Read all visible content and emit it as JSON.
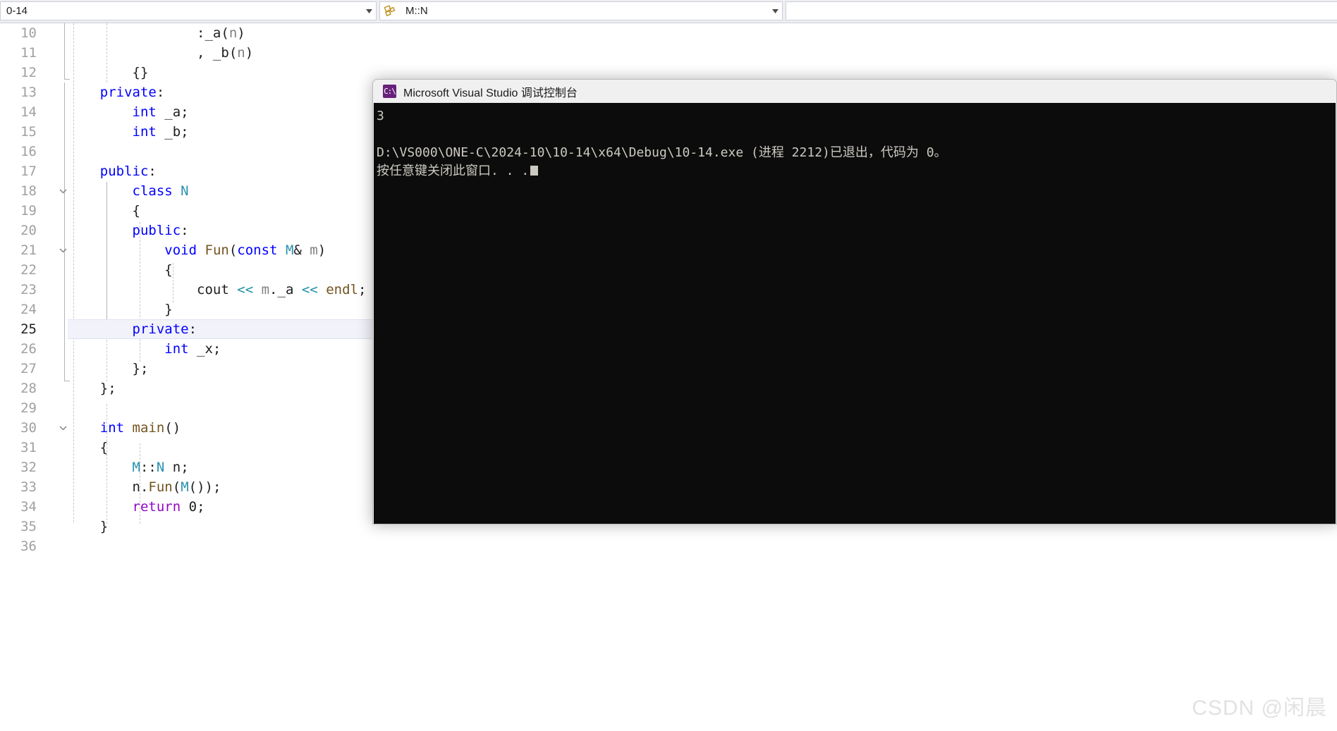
{
  "navbar": {
    "project_selector": {
      "value": "0-14",
      "icon": "chevron-down-icon"
    },
    "scope_selector": {
      "value": "M::N",
      "icon": "namespace-icon",
      "chevron": "chevron-down-icon"
    },
    "member_selector": {
      "value": ""
    }
  },
  "editor": {
    "current_line": 25,
    "lines": [
      {
        "num": "10",
        "indent": 0,
        "fold": "",
        "tokens": [
          {
            "t": "                ",
            "c": "pl"
          },
          {
            "t": ":",
            "c": "br"
          },
          {
            "t": "_a",
            "c": "id"
          },
          {
            "t": "(",
            "c": "br"
          },
          {
            "t": "n",
            "c": "dim"
          },
          {
            "t": ")",
            "c": "br"
          }
        ]
      },
      {
        "num": "11",
        "indent": 0,
        "fold": "",
        "tokens": [
          {
            "t": "                ",
            "c": "pl"
          },
          {
            "t": ",",
            "c": "br"
          },
          {
            "t": " _b",
            "c": "id"
          },
          {
            "t": "(",
            "c": "br"
          },
          {
            "t": "n",
            "c": "dim"
          },
          {
            "t": ")",
            "c": "br"
          }
        ]
      },
      {
        "num": "12",
        "indent": 0,
        "fold": "",
        "tokens": [
          {
            "t": "        ",
            "c": "pl"
          },
          {
            "t": "{}",
            "c": "br"
          }
        ]
      },
      {
        "num": "13",
        "indent": 0,
        "fold": "",
        "tokens": [
          {
            "t": "    ",
            "c": "pl"
          },
          {
            "t": "private",
            "c": "kw"
          },
          {
            "t": ":",
            "c": "br"
          }
        ]
      },
      {
        "num": "14",
        "indent": 0,
        "fold": "",
        "tokens": [
          {
            "t": "        ",
            "c": "pl"
          },
          {
            "t": "int",
            "c": "kw"
          },
          {
            "t": " _a;",
            "c": "id"
          }
        ]
      },
      {
        "num": "15",
        "indent": 0,
        "fold": "",
        "tokens": [
          {
            "t": "        ",
            "c": "pl"
          },
          {
            "t": "int",
            "c": "kw"
          },
          {
            "t": " _b;",
            "c": "id"
          }
        ]
      },
      {
        "num": "16",
        "indent": 0,
        "fold": "",
        "tokens": []
      },
      {
        "num": "17",
        "indent": 0,
        "fold": "",
        "tokens": [
          {
            "t": "    ",
            "c": "pl"
          },
          {
            "t": "public",
            "c": "kw"
          },
          {
            "t": ":",
            "c": "br"
          }
        ]
      },
      {
        "num": "18",
        "indent": 0,
        "fold": "chevron-down",
        "tokens": [
          {
            "t": "        ",
            "c": "pl"
          },
          {
            "t": "class",
            "c": "kw"
          },
          {
            "t": " ",
            "c": "pl"
          },
          {
            "t": "N",
            "c": "typ"
          }
        ]
      },
      {
        "num": "19",
        "indent": 0,
        "fold": "",
        "tokens": [
          {
            "t": "        ",
            "c": "pl"
          },
          {
            "t": "{",
            "c": "br"
          }
        ]
      },
      {
        "num": "20",
        "indent": 0,
        "fold": "",
        "tokens": [
          {
            "t": "        ",
            "c": "pl"
          },
          {
            "t": "public",
            "c": "kw"
          },
          {
            "t": ":",
            "c": "br"
          }
        ]
      },
      {
        "num": "21",
        "indent": 0,
        "fold": "chevron-down",
        "tokens": [
          {
            "t": "            ",
            "c": "pl"
          },
          {
            "t": "void",
            "c": "kw"
          },
          {
            "t": " ",
            "c": "pl"
          },
          {
            "t": "Fun",
            "c": "fn"
          },
          {
            "t": "(",
            "c": "br"
          },
          {
            "t": "const",
            "c": "kw"
          },
          {
            "t": " ",
            "c": "pl"
          },
          {
            "t": "M",
            "c": "typ"
          },
          {
            "t": "&",
            "c": "br"
          },
          {
            "t": " ",
            "c": "pl"
          },
          {
            "t": "m",
            "c": "dim"
          },
          {
            "t": ")",
            "c": "br"
          }
        ]
      },
      {
        "num": "22",
        "indent": 0,
        "fold": "",
        "tokens": [
          {
            "t": "            ",
            "c": "pl"
          },
          {
            "t": "{",
            "c": "br"
          }
        ]
      },
      {
        "num": "23",
        "indent": 0,
        "fold": "",
        "tokens": [
          {
            "t": "                ",
            "c": "pl"
          },
          {
            "t": "cout",
            "c": "id"
          },
          {
            "t": " ",
            "c": "pl"
          },
          {
            "t": "<<",
            "c": "op"
          },
          {
            "t": " ",
            "c": "pl"
          },
          {
            "t": "m",
            "c": "dim"
          },
          {
            "t": ".",
            "c": "br"
          },
          {
            "t": "_a",
            "c": "id"
          },
          {
            "t": " ",
            "c": "pl"
          },
          {
            "t": "<<",
            "c": "op"
          },
          {
            "t": " ",
            "c": "pl"
          },
          {
            "t": "endl",
            "c": "fn"
          },
          {
            "t": ";",
            "c": "br"
          }
        ]
      },
      {
        "num": "24",
        "indent": 0,
        "fold": "",
        "tokens": [
          {
            "t": "            ",
            "c": "pl"
          },
          {
            "t": "}",
            "c": "br"
          }
        ]
      },
      {
        "num": "25",
        "indent": 0,
        "fold": "",
        "tokens": [
          {
            "t": "        ",
            "c": "pl"
          },
          {
            "t": "private",
            "c": "kw"
          },
          {
            "t": ":",
            "c": "br"
          }
        ]
      },
      {
        "num": "26",
        "indent": 0,
        "fold": "",
        "tokens": [
          {
            "t": "            ",
            "c": "pl"
          },
          {
            "t": "int",
            "c": "kw"
          },
          {
            "t": " _x;",
            "c": "id"
          }
        ]
      },
      {
        "num": "27",
        "indent": 0,
        "fold": "",
        "tokens": [
          {
            "t": "        ",
            "c": "pl"
          },
          {
            "t": "};",
            "c": "br"
          }
        ]
      },
      {
        "num": "28",
        "indent": 0,
        "fold": "",
        "tokens": [
          {
            "t": "    ",
            "c": "pl"
          },
          {
            "t": "};",
            "c": "br"
          }
        ]
      },
      {
        "num": "29",
        "indent": 0,
        "fold": "",
        "tokens": []
      },
      {
        "num": "30",
        "indent": 0,
        "fold": "chevron-down",
        "tokens": [
          {
            "t": "    ",
            "c": "pl"
          },
          {
            "t": "int",
            "c": "kw"
          },
          {
            "t": " ",
            "c": "pl"
          },
          {
            "t": "main",
            "c": "fn"
          },
          {
            "t": "()",
            "c": "br"
          }
        ]
      },
      {
        "num": "31",
        "indent": 0,
        "fold": "",
        "tokens": [
          {
            "t": "    ",
            "c": "pl"
          },
          {
            "t": "{",
            "c": "br"
          }
        ]
      },
      {
        "num": "32",
        "indent": 0,
        "fold": "",
        "tokens": [
          {
            "t": "        ",
            "c": "pl"
          },
          {
            "t": "M",
            "c": "typ"
          },
          {
            "t": "::",
            "c": "br"
          },
          {
            "t": "N",
            "c": "typ"
          },
          {
            "t": " ",
            "c": "pl"
          },
          {
            "t": "n",
            "c": "id"
          },
          {
            "t": ";",
            "c": "br"
          }
        ]
      },
      {
        "num": "33",
        "indent": 0,
        "fold": "",
        "tokens": [
          {
            "t": "        ",
            "c": "pl"
          },
          {
            "t": "n",
            "c": "id"
          },
          {
            "t": ".",
            "c": "br"
          },
          {
            "t": "Fun",
            "c": "fn"
          },
          {
            "t": "(",
            "c": "br"
          },
          {
            "t": "M",
            "c": "typ"
          },
          {
            "t": "()",
            "c": "br"
          },
          {
            "t": ");",
            "c": "br"
          }
        ]
      },
      {
        "num": "34",
        "indent": 0,
        "fold": "",
        "tokens": [
          {
            "t": "        ",
            "c": "pl"
          },
          {
            "t": "return",
            "c": "ctl"
          },
          {
            "t": " ",
            "c": "pl"
          },
          {
            "t": "0",
            "c": "num"
          },
          {
            "t": ";",
            "c": "br"
          }
        ]
      },
      {
        "num": "35",
        "indent": 0,
        "fold": "",
        "tokens": [
          {
            "t": "    ",
            "c": "pl"
          },
          {
            "t": "}",
            "c": "br"
          }
        ]
      },
      {
        "num": "36",
        "indent": 0,
        "fold": "",
        "tokens": []
      }
    ]
  },
  "console": {
    "title": "Microsoft Visual Studio 调试控制台",
    "icon": "console-app-icon",
    "output_lines": [
      "3",
      "",
      "D:\\VS000\\ONE-C\\2024-10\\10-14\\x64\\Debug\\10-14.exe (进程 2212)已退出，代码为 0。",
      "按任意键关闭此窗口. . ."
    ]
  },
  "watermark": {
    "text": "CSDN @闲晨"
  },
  "colors": {
    "keyword": "#0000ff",
    "type": "#2b91af",
    "function": "#74531f",
    "operator": "#1f8fa8",
    "control": "#8f08c4",
    "current_line_bg": "#f2f2fa",
    "console_bg": "#0c0c0c",
    "console_fg": "#ccc9c1",
    "vs_purple": "#68217a",
    "chrome_bg": "#eeeef2"
  }
}
